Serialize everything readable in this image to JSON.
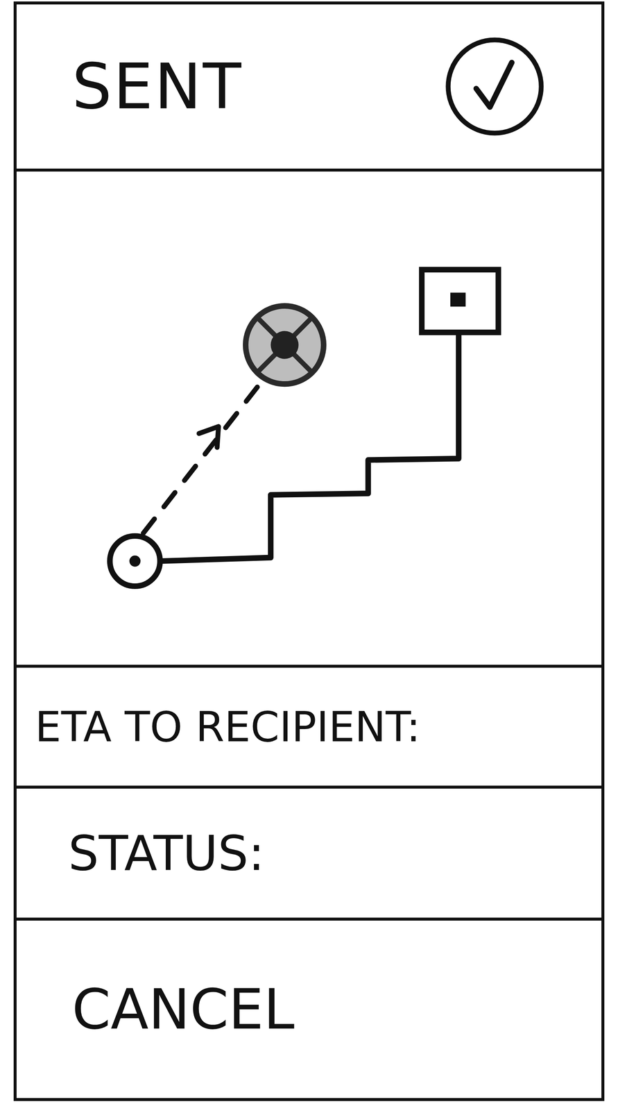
{
  "header": {
    "title": "SENT"
  },
  "fields": [
    {
      "label": "ETA TO RECIPIENT:"
    },
    {
      "label": "STATUS:"
    }
  ],
  "buttons": [
    "CANCEL"
  ]
}
